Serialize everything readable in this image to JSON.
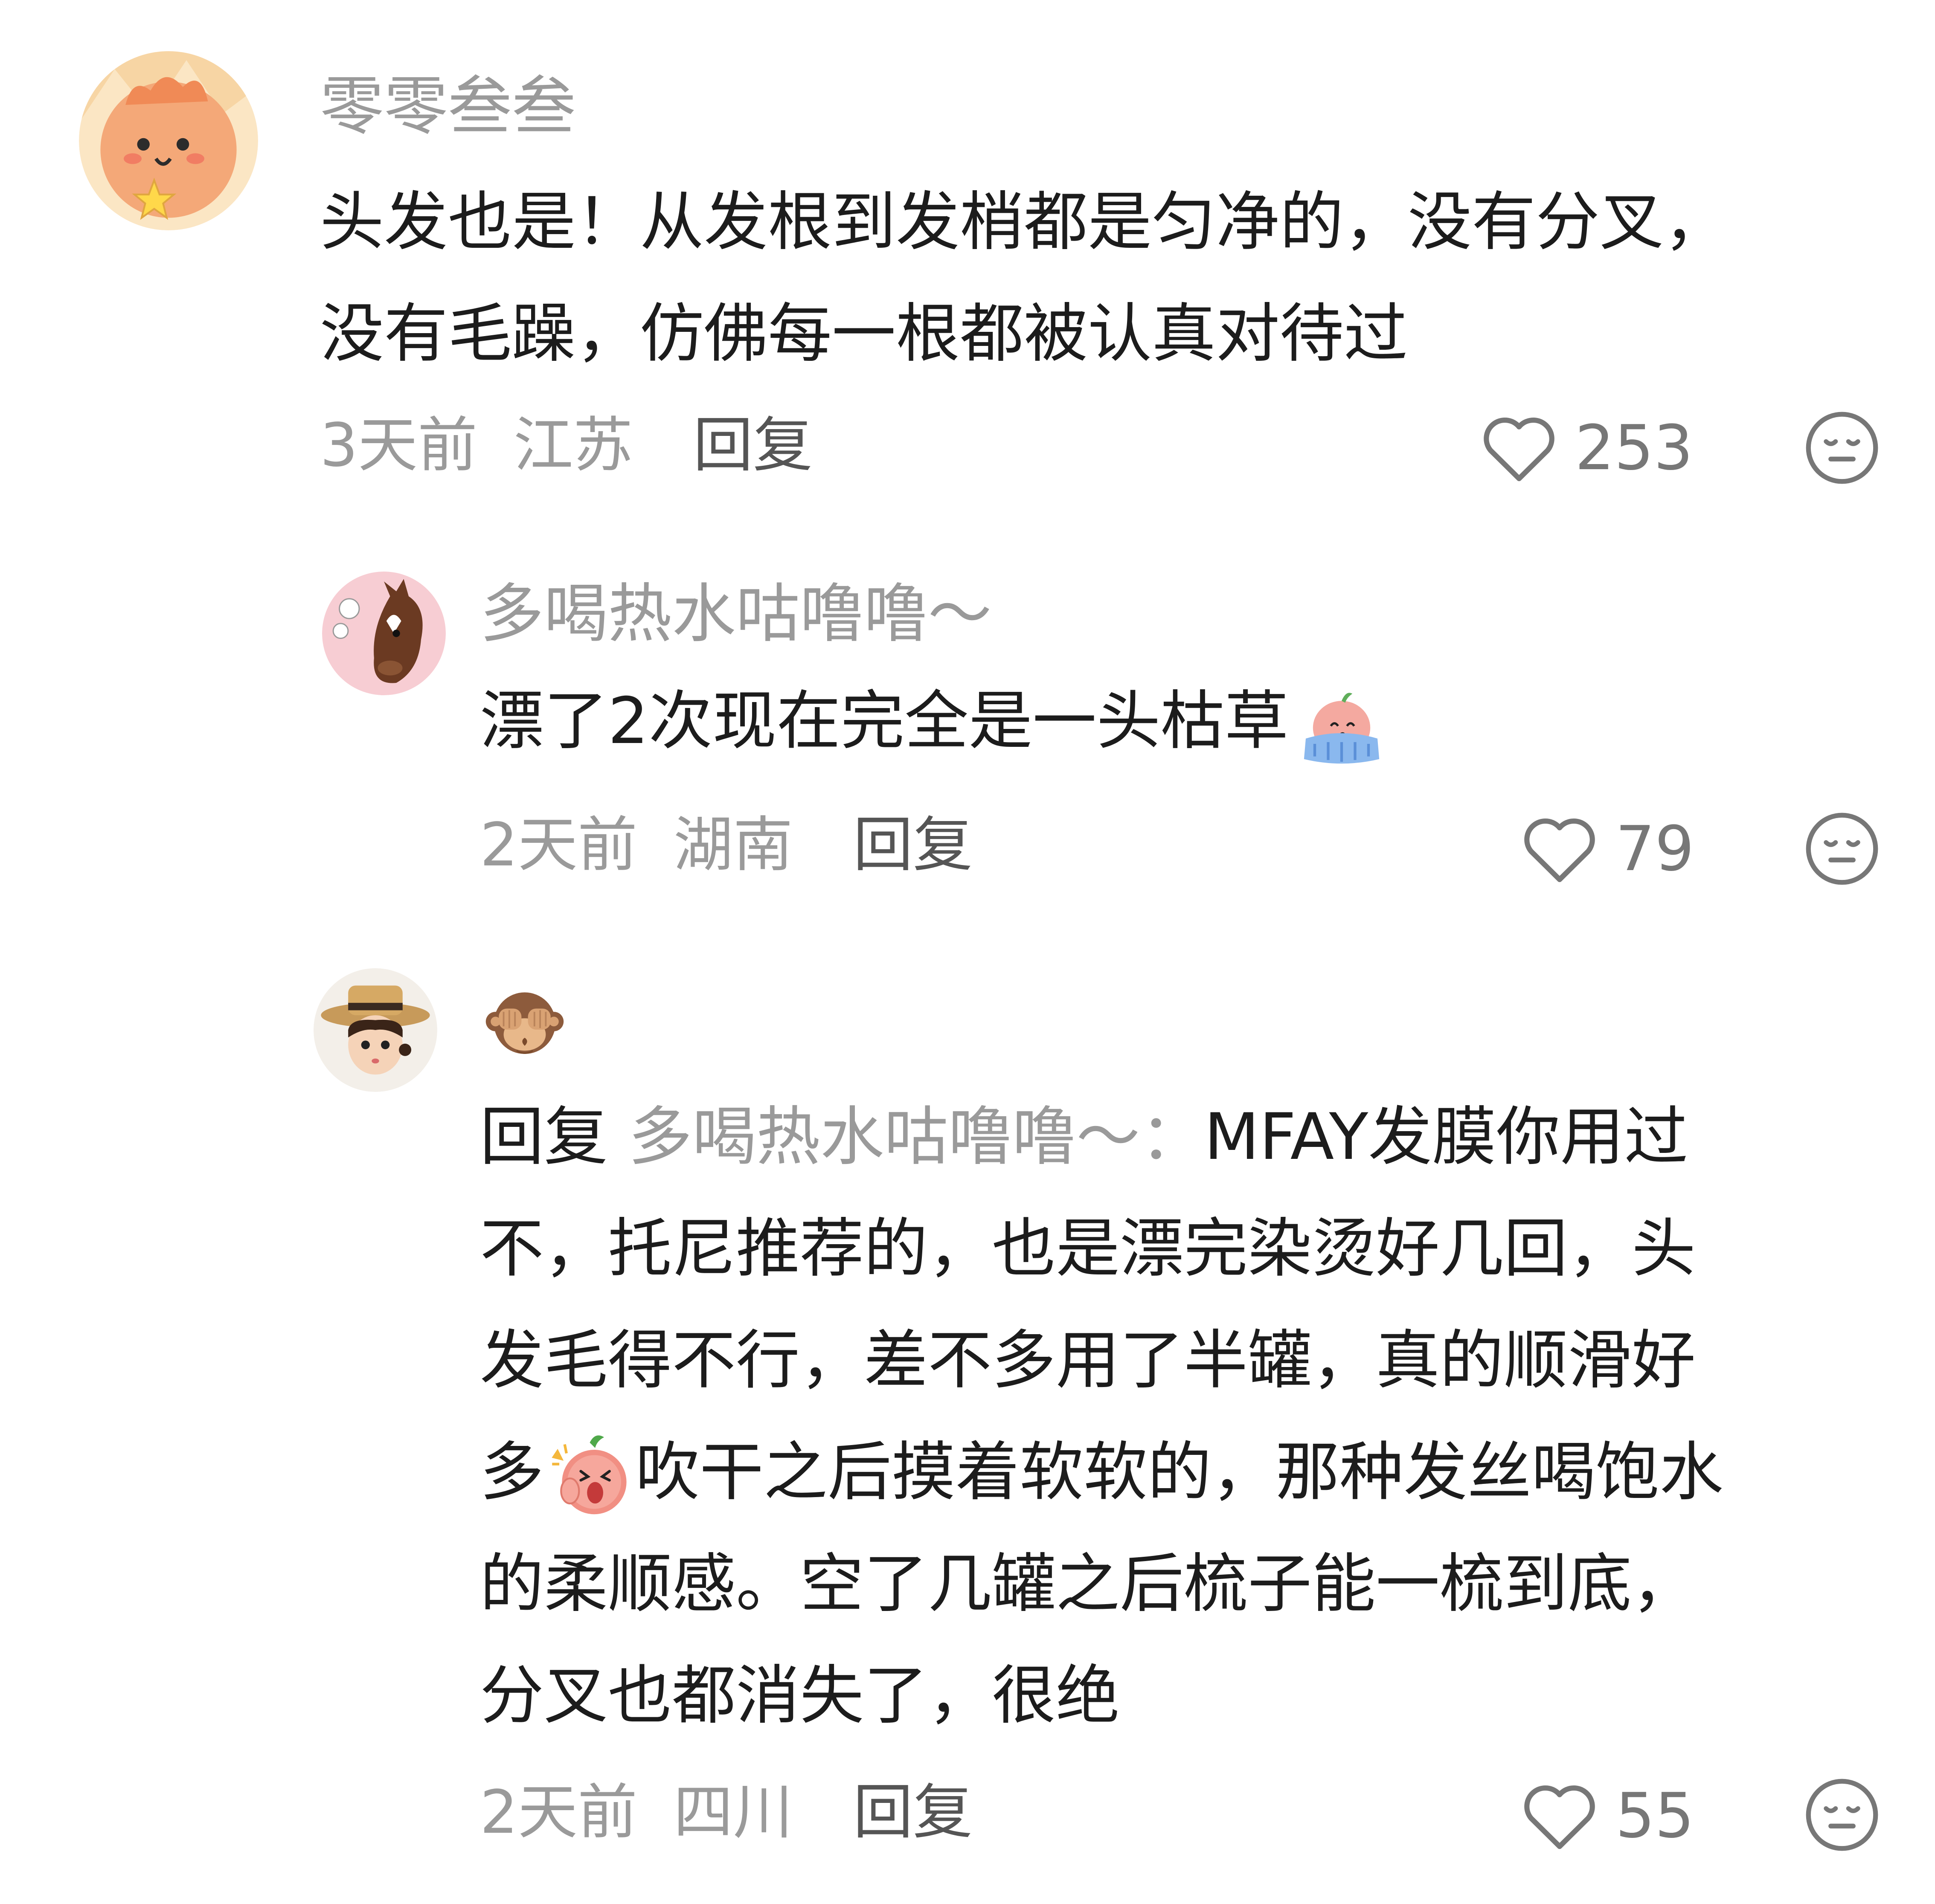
{
  "comments": [
    {
      "username": "零零叁叁",
      "lines": [
        "头发也是！从发根到发梢都是匀净的，没有分叉，",
        "没有毛躁，仿佛每一根都被认真对待过"
      ],
      "time": "3天前",
      "location": "江苏",
      "reply_label": "回复",
      "likes": "253",
      "avatar_icon": "cartoon-orange-character-avatar"
    },
    {
      "username": "多喝热水咕噜噜～",
      "lines": [
        "漂了2次现在完全是一头枯草"
      ],
      "inline_emoji": "crying-peach-emoji",
      "time": "2天前",
      "location": "湖南",
      "reply_label": "回复",
      "likes": "79",
      "avatar_icon": "cartoon-horse-avatar"
    },
    {
      "username_emoji": "see-no-evil-monkey-emoji",
      "reply_prefix": "回复",
      "reply_target": "多喝热水咕噜噜～：",
      "first_line_rest": "MFAY发膜你用过",
      "lines": [
        "不，托尼推荐的，也是漂完染烫好几回，头",
        "发毛得不行，差不多用了半罐，真的顺滑好"
      ],
      "line_with_emoji_before": "多",
      "inline_emoji": "shocked-peach-emoji",
      "line_with_emoji_after": "吹干之后摸着软软的，那种发丝喝饱水",
      "lines_after": [
        "的柔顺感。空了几罐之后梳子能一梳到底，",
        "分叉也都消失了，很绝"
      ],
      "time": "2天前",
      "location": "四川",
      "reply_label": "回复",
      "likes": "55",
      "avatar_icon": "cartoon-girl-straw-hat-avatar"
    }
  ],
  "colors": {
    "primary_text": "#1c1c1c",
    "secondary_text": "#9a9a9a",
    "icon_gray": "#777777"
  }
}
